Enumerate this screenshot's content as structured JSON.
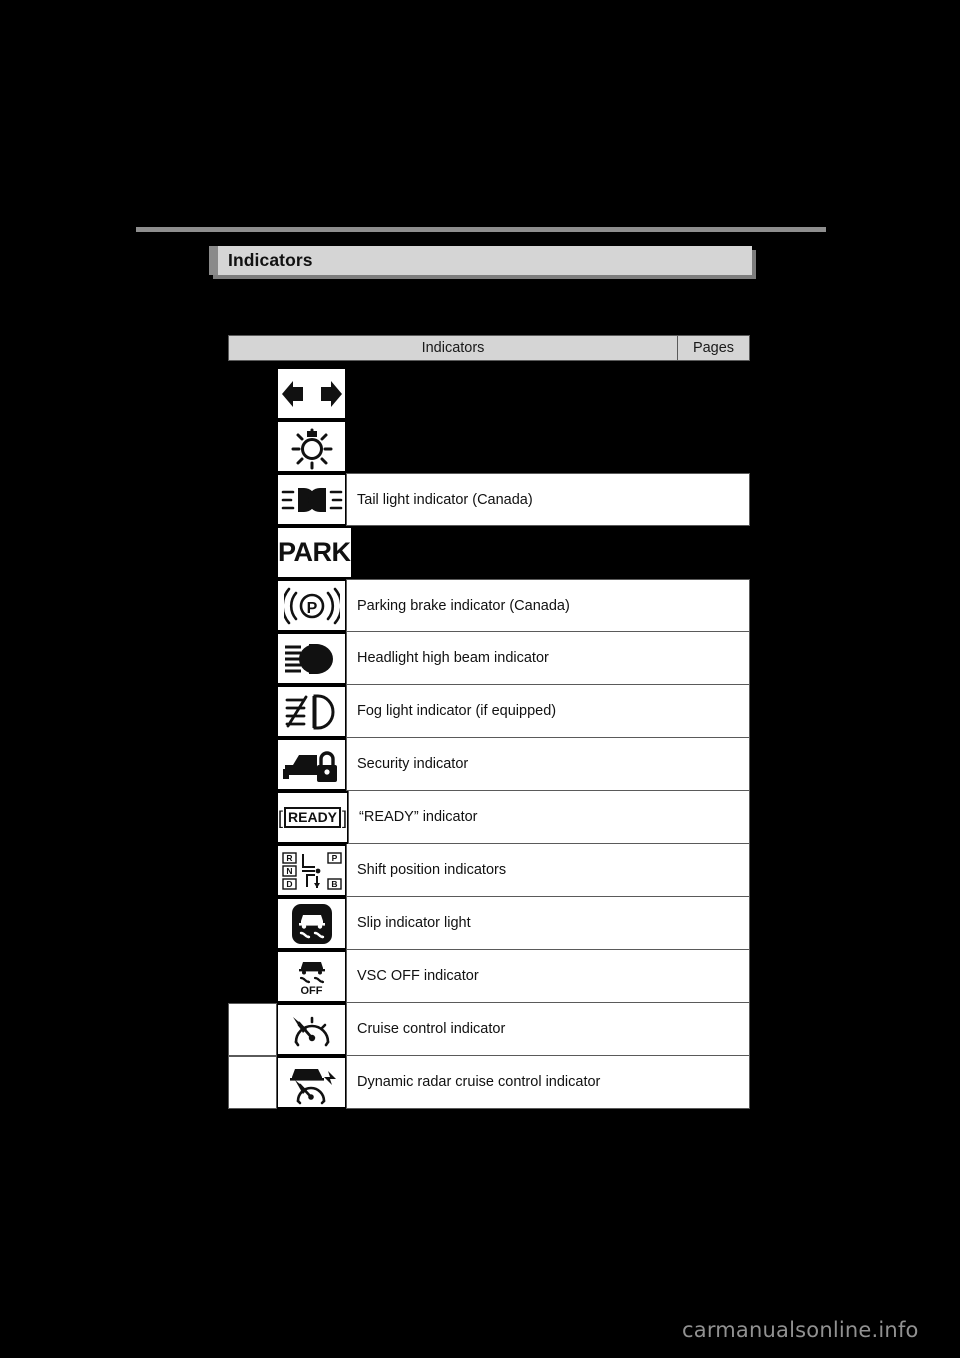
{
  "page": {
    "background_color": "#000000",
    "watermark": "carmanualsonline.info"
  },
  "section": {
    "title": "Indicators",
    "bar_color": "#d5d5d5",
    "tab_color": "#8a8a8a",
    "rule_color": "#8e8e8e"
  },
  "table": {
    "header": {
      "col_indicators": "Indicators",
      "col_pages": "Pages"
    },
    "rows": [
      {
        "icon": "turn-signal-arrows-icon",
        "description": "",
        "description_visible": false,
        "pages": "",
        "pages_cell_visible": false
      },
      {
        "icon": "light-reminder-bulb-icon",
        "description": "",
        "description_visible": false,
        "pages": "",
        "pages_cell_visible": false
      },
      {
        "icon": "tail-light-icon",
        "description": "Tail light indicator (Canada)",
        "description_visible": true,
        "pages": "",
        "pages_cell_visible": false
      },
      {
        "icon": "park-text-icon",
        "description": "",
        "description_visible": false,
        "pages": "",
        "pages_cell_visible": false
      },
      {
        "icon": "parking-brake-icon",
        "description": "Parking brake indicator (Canada)",
        "description_visible": true,
        "pages": "",
        "pages_cell_visible": false
      },
      {
        "icon": "headlight-high-beam-icon",
        "description": "Headlight high beam indicator",
        "description_visible": true,
        "pages": "",
        "pages_cell_visible": false
      },
      {
        "icon": "fog-light-icon",
        "description": "Fog light indicator (if equipped)",
        "description_visible": true,
        "pages": "",
        "pages_cell_visible": false
      },
      {
        "icon": "security-indicator-icon",
        "description": "Security indicator",
        "description_visible": true,
        "pages": "",
        "pages_cell_visible": false
      },
      {
        "icon": "ready-indicator-icon",
        "description": "“READY” indicator",
        "description_visible": true,
        "pages": "",
        "pages_cell_visible": false
      },
      {
        "icon": "shift-position-icon",
        "description": "Shift position indicators",
        "description_visible": true,
        "pages": "",
        "pages_cell_visible": false
      },
      {
        "icon": "slip-indicator-icon",
        "description": "Slip indicator light",
        "description_visible": true,
        "pages": "",
        "pages_cell_visible": false
      },
      {
        "icon": "vsc-off-icon",
        "description": "VSC OFF indicator",
        "description_visible": true,
        "pages": "",
        "pages_cell_visible": false
      },
      {
        "icon": "cruise-control-icon",
        "description": "Cruise control indicator",
        "description_visible": true,
        "pages": "",
        "pages_cell_visible": true
      },
      {
        "icon": "dynamic-radar-cruise-control-icon",
        "description": "Dynamic radar cruise control indicator",
        "description_visible": true,
        "pages": "",
        "pages_cell_visible": true
      }
    ]
  },
  "icon_labels": {
    "park": "PARK",
    "ready": "READY",
    "vsc_off": "OFF",
    "shift_r": "R",
    "shift_n": "N",
    "shift_d": "D",
    "shift_p": "P",
    "shift_b": "B"
  }
}
